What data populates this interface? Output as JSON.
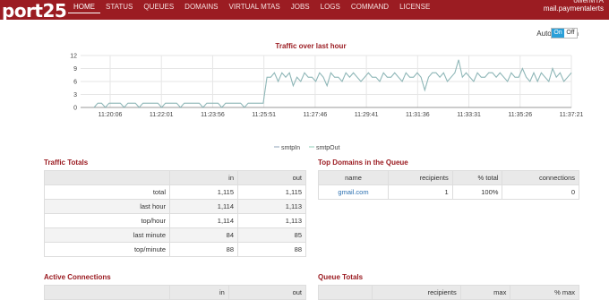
{
  "header": {
    "brand": "port25",
    "nav": [
      "HOME",
      "STATUS",
      "QUEUES",
      "DOMAINS",
      "VIRTUAL MTAS",
      "JOBS",
      "LOGS",
      "COMMAND",
      "LICENSE"
    ],
    "active_nav": "HOME",
    "user_line1": "owerMTA",
    "user_line2": "mail.paymentalerts"
  },
  "auto_refresh": {
    "label": "Auto Refresh",
    "on": "On",
    "off": "Off"
  },
  "traffic_chart": {
    "title": "Traffic over last hour",
    "legend": [
      "smtpIn",
      "smtpOut"
    ],
    "y_ticks": [
      "12",
      "9",
      "6",
      "3",
      "0"
    ],
    "x_ticks": [
      "11:20:06",
      "11:22:01",
      "11:23:56",
      "11:25:51",
      "11:27:46",
      "11:29:41",
      "11:31:36",
      "11:33:31",
      "11:35:26",
      "11:37:21"
    ],
    "colors": {
      "line": "#8fcfb8",
      "grid": "#e6e6e6"
    }
  },
  "chart_data": {
    "type": "line",
    "title": "Traffic over last hour",
    "ylim": [
      0,
      12
    ],
    "x_start": "11:19:05",
    "x_end": "11:37:21",
    "series": [
      {
        "name": "smtpOut",
        "values": [
          0,
          1,
          1,
          0,
          1,
          1,
          1,
          1,
          0,
          1,
          1,
          1,
          0,
          1,
          1,
          1,
          1,
          1,
          0,
          1,
          1,
          1,
          1,
          0,
          1,
          1,
          1,
          1,
          1,
          0,
          1,
          1,
          1,
          1,
          0,
          1,
          1,
          1,
          1,
          1,
          0,
          1,
          1,
          1,
          1,
          1,
          7,
          7,
          8,
          6,
          8,
          7,
          8,
          5,
          7,
          6,
          8,
          7,
          7,
          6,
          8,
          7,
          5,
          8,
          7,
          7,
          6,
          8,
          7,
          8,
          7,
          6,
          7,
          8,
          7,
          7,
          6,
          8,
          7,
          7,
          8,
          7,
          6,
          8,
          7,
          7,
          8,
          7,
          4,
          7,
          8,
          8,
          7,
          8,
          6,
          7,
          8,
          11,
          7,
          8,
          7,
          6,
          8,
          7,
          7,
          8,
          8,
          7,
          8,
          7,
          6,
          8,
          7,
          7,
          9,
          7,
          6,
          8,
          6,
          8,
          7,
          6,
          9,
          7,
          8,
          6,
          7,
          8
        ]
      },
      {
        "name": "smtpIn",
        "values": [
          0,
          1,
          1,
          0,
          1,
          1,
          1,
          1,
          0,
          1,
          1,
          1,
          0,
          1,
          1,
          1,
          1,
          1,
          0,
          1,
          1,
          1,
          1,
          0,
          1,
          1,
          1,
          1,
          1,
          0,
          1,
          1,
          1,
          1,
          0,
          1,
          1,
          1,
          1,
          1,
          0,
          1,
          1,
          1,
          1,
          1,
          7,
          7,
          8,
          6,
          8,
          7,
          8,
          5,
          7,
          6,
          8,
          7,
          7,
          6,
          8,
          7,
          5,
          8,
          7,
          7,
          6,
          8,
          7,
          8,
          7,
          6,
          7,
          8,
          7,
          7,
          6,
          8,
          7,
          7,
          8,
          7,
          6,
          8,
          7,
          7,
          8,
          7,
          4,
          7,
          8,
          8,
          7,
          8,
          6,
          7,
          8,
          11,
          7,
          8,
          7,
          6,
          8,
          7,
          7,
          8,
          8,
          7,
          8,
          7,
          6,
          8,
          7,
          7,
          9,
          7,
          6,
          8,
          6,
          8,
          7,
          6,
          9,
          7,
          8,
          6,
          7,
          8
        ]
      }
    ]
  },
  "traffic_totals": {
    "title": "Traffic Totals",
    "headers": [
      "",
      "in",
      "out"
    ],
    "rows": [
      [
        "total",
        "1,115",
        "1,115"
      ],
      [
        "last hour",
        "1,114",
        "1,113"
      ],
      [
        "top/hour",
        "1,114",
        "1,113"
      ],
      [
        "last minute",
        "84",
        "85"
      ],
      [
        "top/minute",
        "88",
        "88"
      ]
    ]
  },
  "top_domains": {
    "title": "Top Domains in the Queue",
    "headers": [
      "name",
      "recipients",
      "% total",
      "connections"
    ],
    "rows": [
      [
        "gmail.com",
        "1",
        "100%",
        "0"
      ]
    ]
  },
  "active_connections": {
    "title": "Active Connections",
    "headers": [
      "",
      "in",
      "out"
    ]
  },
  "queue_totals": {
    "title": "Queue Totals",
    "headers": [
      "",
      "recipients",
      "max",
      "% max"
    ]
  }
}
